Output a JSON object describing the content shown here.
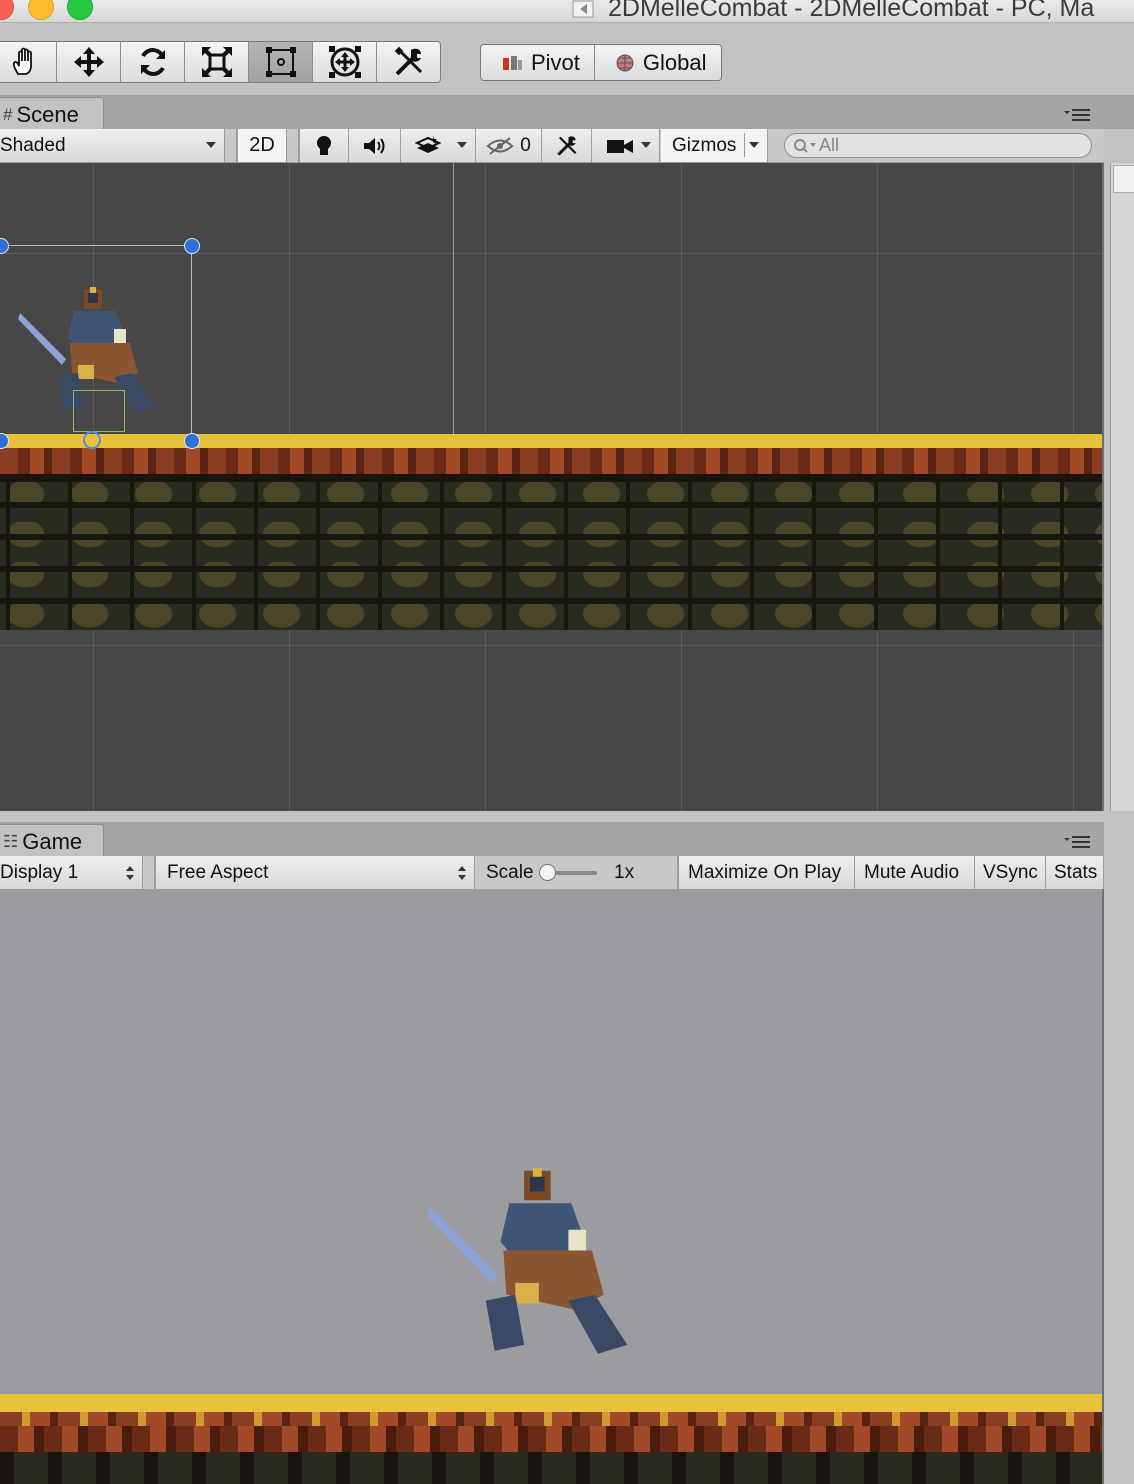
{
  "window": {
    "title": "2DMelleCombat - 2DMelleCombat - PC, Ma"
  },
  "toolbar": {
    "transform_tools": [
      {
        "name": "hand-tool",
        "icon": "hand-icon"
      },
      {
        "name": "move-tool",
        "icon": "move-icon"
      },
      {
        "name": "rotate-tool",
        "icon": "rotate-icon"
      },
      {
        "name": "scale-tool",
        "icon": "scale-icon"
      },
      {
        "name": "rect-tool",
        "icon": "rect-transform-icon",
        "active": true
      },
      {
        "name": "transform-tool",
        "icon": "transform-icon"
      },
      {
        "name": "custom-tool",
        "icon": "custom-tools-icon"
      }
    ],
    "pivot_label": "Pivot",
    "global_label": "Global"
  },
  "scene": {
    "tab_label": "Scene",
    "shading_mode": "Shaded",
    "mode_2d_label": "2D",
    "hidden_count": "0",
    "gizmos_label": "Gizmos",
    "search_placeholder": "All"
  },
  "game": {
    "tab_label": "Game",
    "display": "Display 1",
    "aspect": "Free Aspect",
    "scale_label": "Scale",
    "scale_value": "1x",
    "maximize_label": "Maximize On Play",
    "mute_label": "Mute Audio",
    "vsync_label": "VSync",
    "stats_label": "Stats"
  },
  "colors": {
    "scene_bg": "#474747",
    "game_bg": "#9a9ca0",
    "ground_top": "#e8c23c",
    "gizmo_handle": "#2f6fd6"
  }
}
